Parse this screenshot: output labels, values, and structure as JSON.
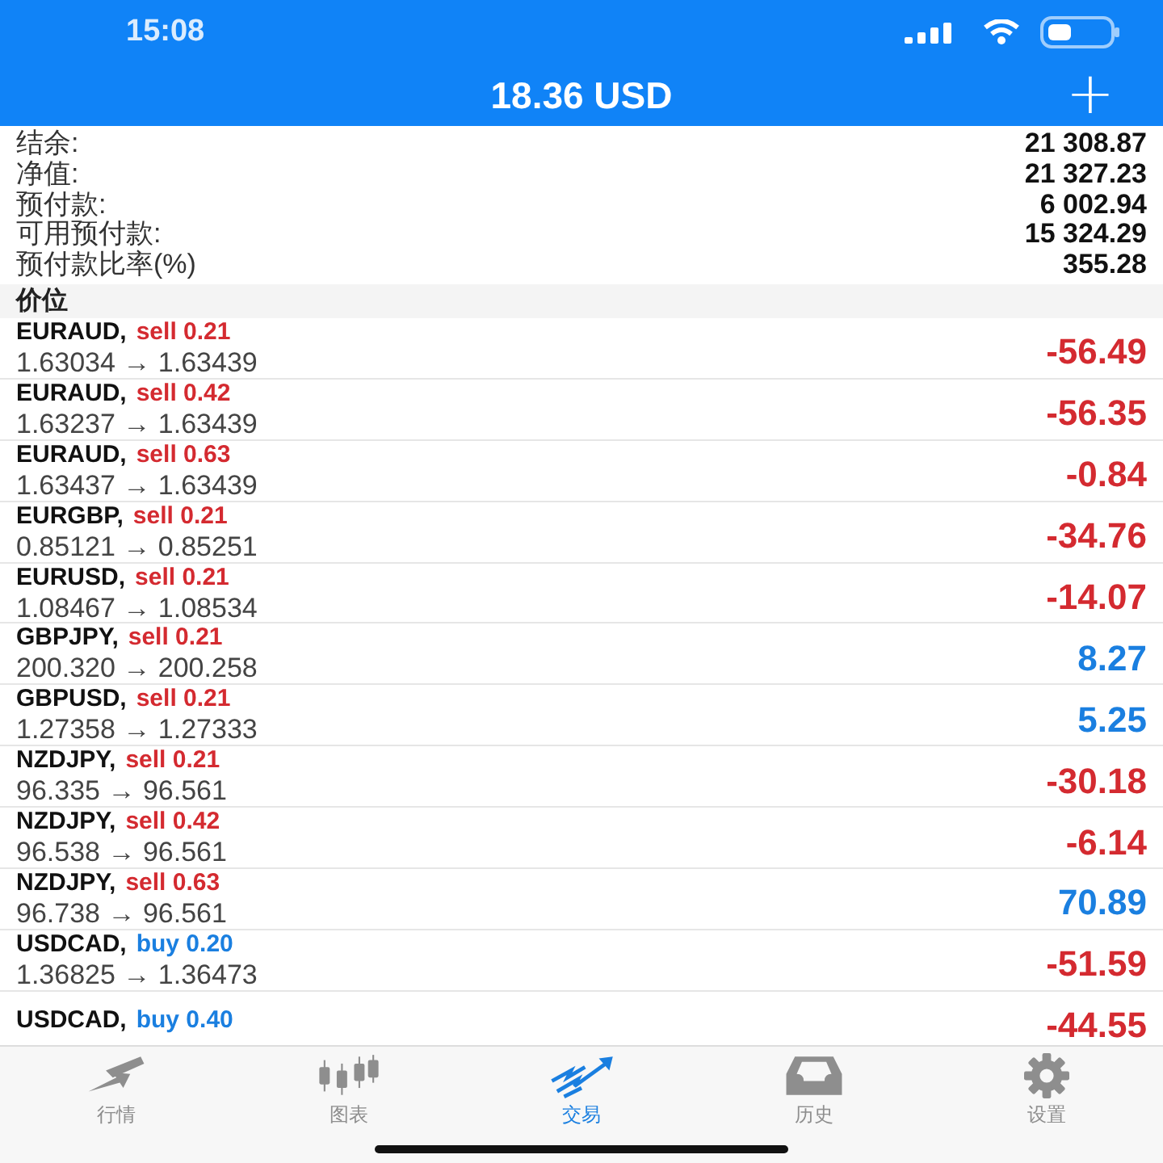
{
  "status_bar": {
    "time": "15:08"
  },
  "header": {
    "title": "18.36 USD",
    "add": "+"
  },
  "summary": [
    {
      "label": "结余:",
      "value": "21 308.87"
    },
    {
      "label": "净值:",
      "value": "21 327.23"
    },
    {
      "label": "预付款:",
      "value": "6 002.94"
    },
    {
      "label": "可用预付款:",
      "value": "15 324.29"
    },
    {
      "label": "预付款比率(%)",
      "value": "355.28"
    }
  ],
  "section": "价位",
  "positions": [
    {
      "symbol": "EURAUD,",
      "kind": "sell",
      "order": "sell 0.21",
      "prices": "1.63034 → 1.63439",
      "profit": {
        "text": "-56.49",
        "color": "#d42a30"
      }
    },
    {
      "symbol": "EURAUD,",
      "kind": "sell",
      "order": "sell 0.42",
      "prices": "1.63237 → 1.63439",
      "profit": {
        "text": "-56.35",
        "color": "#d42a30"
      }
    },
    {
      "symbol": "EURAUD,",
      "kind": "sell",
      "order": "sell 0.63",
      "prices": "1.63437 → 1.63439",
      "profit": {
        "text": "-0.84",
        "color": "#d42a30"
      }
    },
    {
      "symbol": "EURGBP,",
      "kind": "sell",
      "order": "sell 0.21",
      "prices": "0.85121 → 0.85251",
      "profit": {
        "text": "-34.76",
        "color": "#d42a30"
      }
    },
    {
      "symbol": "EURUSD,",
      "kind": "sell",
      "order": "sell 0.21",
      "prices": "1.08467 → 1.08534",
      "profit": {
        "text": "-14.07",
        "color": "#d42a30"
      }
    },
    {
      "symbol": "GBPJPY,",
      "kind": "sell",
      "order": "sell 0.21",
      "prices": "200.320 → 200.258",
      "profit": {
        "text": "8.27",
        "color": "#1a7fe0"
      }
    },
    {
      "symbol": "GBPUSD,",
      "kind": "sell",
      "order": "sell 0.21",
      "prices": "1.27358 → 1.27333",
      "profit": {
        "text": "5.25",
        "color": "#1a7fe0"
      }
    },
    {
      "symbol": "NZDJPY,",
      "kind": "sell",
      "order": "sell 0.21",
      "prices": "96.335 → 96.561",
      "profit": {
        "text": "-30.18",
        "color": "#d42a30"
      }
    },
    {
      "symbol": "NZDJPY,",
      "kind": "sell",
      "order": "sell 0.42",
      "prices": "96.538 → 96.561",
      "profit": {
        "text": "-6.14",
        "color": "#d42a30"
      }
    },
    {
      "symbol": "NZDJPY,",
      "kind": "sell",
      "order": "sell 0.63",
      "prices": "96.738 → 96.561",
      "profit": {
        "text": "70.89",
        "color": "#1a7fe0"
      }
    },
    {
      "symbol": "USDCAD,",
      "kind": "buy",
      "order": "buy 0.20",
      "prices": "1.36825 → 1.36473",
      "profit": {
        "text": "-51.59",
        "color": "#d42a30"
      }
    },
    {
      "symbol": "USDCAD,",
      "kind": "buy",
      "order": "buy 0.40",
      "profit": {
        "text": "-44.55",
        "color": "#d42a30"
      }
    }
  ],
  "tabs": [
    {
      "kind": "quotes",
      "label": "行情",
      "selected": false
    },
    {
      "kind": "chart",
      "label": "图表",
      "selected": false
    },
    {
      "kind": "trade",
      "label": "交易",
      "selected": true
    },
    {
      "kind": "history",
      "label": "历史",
      "selected": false
    },
    {
      "kind": "settings",
      "label": "设置",
      "selected": false
    }
  ]
}
